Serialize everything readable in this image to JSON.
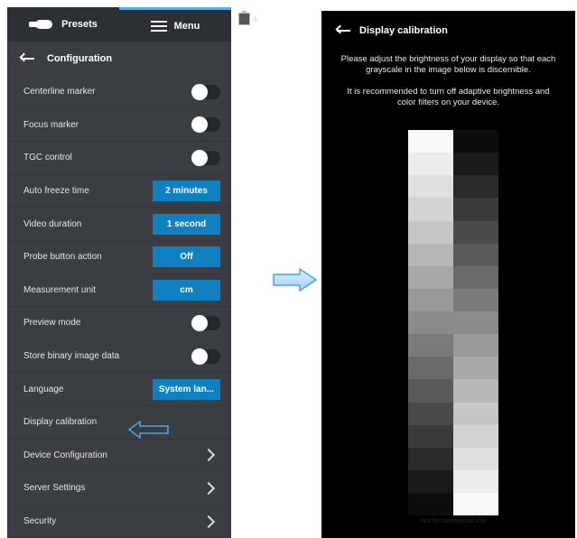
{
  "left_panel": {
    "tabs": {
      "presets_label": "Presets",
      "menu_label": "Menu"
    },
    "header": {
      "title": "Configuration"
    },
    "rows": [
      {
        "label": "Centerline marker",
        "control": "toggle"
      },
      {
        "label": "Focus marker",
        "control": "toggle"
      },
      {
        "label": "TGC control",
        "control": "toggle"
      },
      {
        "label": "Auto freeze time",
        "control": "button",
        "value": "2 minutes"
      },
      {
        "label": "Video duration",
        "control": "button",
        "value": "1 second"
      },
      {
        "label": "Probe button action",
        "control": "button",
        "value": "Off"
      },
      {
        "label": "Measurement unit",
        "control": "button",
        "value": "cm"
      },
      {
        "label": "Preview mode",
        "control": "toggle"
      },
      {
        "label": "Store binary image data",
        "control": "toggle"
      },
      {
        "label": "Language",
        "control": "button",
        "value": "System lan..."
      },
      {
        "label": "Display calibration",
        "control": "none"
      },
      {
        "label": "Device Configuration",
        "control": "chevron"
      },
      {
        "label": "Server Settings",
        "control": "chevron"
      },
      {
        "label": "Security",
        "control": "chevron"
      }
    ]
  },
  "badge": {
    "count": "4",
    "icon": "clipboard-icon"
  },
  "right_panel": {
    "header": {
      "title": "Display calibration"
    },
    "instruction_1": "Please adjust the brightness of your display so that each grayscale in the image below is discernible.",
    "instruction_2": "It is recommended to turn off adaptive brightness and color filters on your device.",
    "grayscale": {
      "left_column": [
        "#f8f8f8",
        "#ececec",
        "#dfdfdf",
        "#d3d3d3",
        "#c6c6c6",
        "#b7b7b7",
        "#a8a8a8",
        "#999999",
        "#8a8a8a",
        "#7a7a7a",
        "#6a6a6a",
        "#5a5a5a",
        "#4a4a4a",
        "#3a3a3a",
        "#2a2a2a",
        "#1a1a1a",
        "#0d0d0d"
      ],
      "right_column": [
        "#0d0d0d",
        "#1a1a1a",
        "#2a2a2a",
        "#3a3a3a",
        "#4a4a4a",
        "#5a5a5a",
        "#6a6a6a",
        "#7a7a7a",
        "#8a8a8a",
        "#999999",
        "#a8a8a8",
        "#b7b7b7",
        "#c6c6c6",
        "#d3d3d3",
        "#dfdfdf",
        "#ececec",
        "#f8f8f8"
      ]
    },
    "footnote": "Not for commercial use"
  },
  "colors": {
    "accent": "#1180c0",
    "tab_indicator": "#5aaee0",
    "pointer_arrow": "#4aa3dc"
  }
}
